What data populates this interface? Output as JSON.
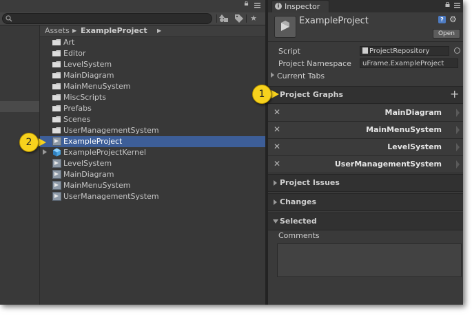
{
  "project": {
    "breadcrumb": [
      "Assets",
      "ExampleProject"
    ],
    "items": [
      {
        "label": "Art",
        "kind": "folder"
      },
      {
        "label": "Editor",
        "kind": "folder"
      },
      {
        "label": "LevelSystem",
        "kind": "folder"
      },
      {
        "label": "MainDiagram",
        "kind": "folder"
      },
      {
        "label": "MainMenuSystem",
        "kind": "folder"
      },
      {
        "label": "MiscScripts",
        "kind": "folder"
      },
      {
        "label": "Prefabs",
        "kind": "folder"
      },
      {
        "label": "Scenes",
        "kind": "folder"
      },
      {
        "label": "UserManagementSystem",
        "kind": "folder"
      },
      {
        "label": "ExampleProject",
        "kind": "uframe-asset",
        "selected": true
      },
      {
        "label": "ExampleProjectKernel",
        "kind": "prefab",
        "expandable": true
      },
      {
        "label": "LevelSystem",
        "kind": "uframe-asset"
      },
      {
        "label": "MainDiagram",
        "kind": "uframe-asset"
      },
      {
        "label": "MainMenuSystem",
        "kind": "uframe-asset"
      },
      {
        "label": "UserManagementSystem",
        "kind": "uframe-asset"
      }
    ],
    "selected_color": "#3d5e98"
  },
  "inspector": {
    "tab_label": "Inspector",
    "header_title": "ExampleProject",
    "open_label": "Open",
    "script_label": "Script",
    "script_value": "ProjectRepository",
    "namespace_label": "Project Namespace",
    "namespace_value": "uFrame.ExampleProject",
    "current_tabs_label": "Current Tabs",
    "graphs_section": "Project Graphs",
    "graphs": [
      "MainDiagram",
      "MainMenuSystem",
      "LevelSystem",
      "UserManagementSystem"
    ],
    "issues_section": "Project Issues",
    "changes_section": "Changes",
    "selected_section": "Selected",
    "comments_label": "Comments"
  },
  "callouts": [
    "1",
    "2"
  ],
  "accent": "#f7d21d"
}
